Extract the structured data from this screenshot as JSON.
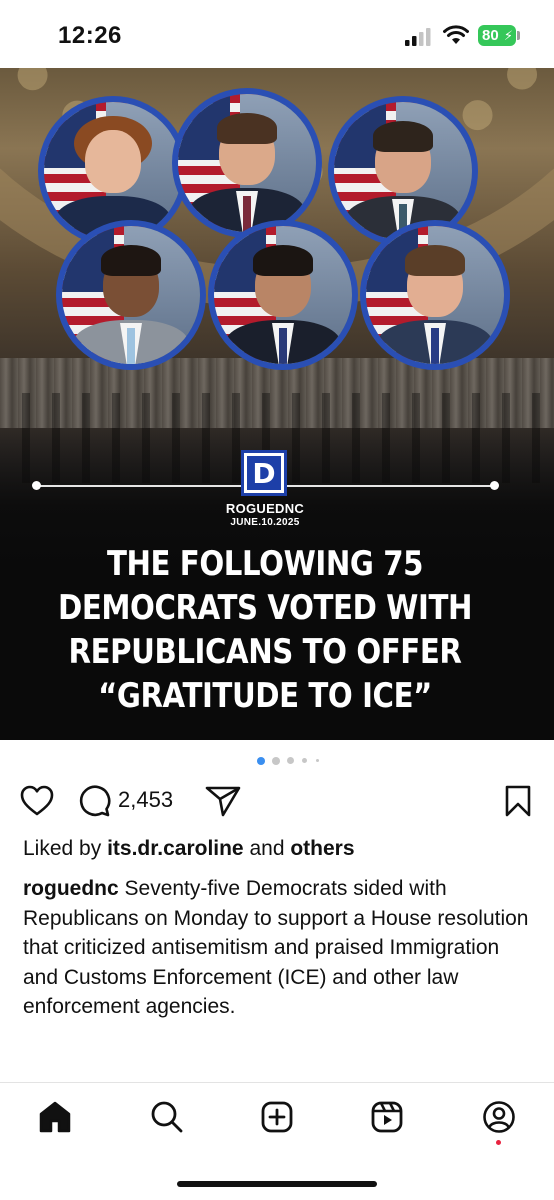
{
  "status_bar": {
    "time": "12:26",
    "battery": "80",
    "battery_color": "#35c759"
  },
  "post": {
    "image": {
      "brand": "ROGUEDNC",
      "date": "JUNE.10.2025",
      "logo_letter": "D",
      "headline_lines": [
        "THE FOLLOWING 75",
        "DEMOCRATS VOTED WITH",
        "REPUBLICANS TO OFFER",
        "“GRATITUDE TO ICE”"
      ],
      "portrait_count": 6,
      "accent_color": "#2a4fb4"
    },
    "carousel": {
      "active_index": 0,
      "total_dots": 5
    },
    "actions": {
      "like_icon": "heart-icon",
      "comment_icon": "comment-icon",
      "comment_count": "2,453",
      "share_icon": "send-icon",
      "save_icon": "bookmark-icon"
    },
    "likes": {
      "prefix": "Liked by ",
      "user": "its.dr.caroline",
      "middle": " and ",
      "suffix": "others"
    },
    "caption": {
      "username": "roguednc",
      "text": " Seventy-five Democrats sided with Republicans on Monday to support a House resolution that criticized antisemitism and praised Immigration and Customs Enforcement (ICE) and other law enforcement agencies."
    }
  },
  "bottom_nav": {
    "items": [
      "home-icon",
      "search-icon",
      "create-icon",
      "reels-icon",
      "profile-icon"
    ],
    "active": "home-icon",
    "notification_color": "#e8233f"
  }
}
